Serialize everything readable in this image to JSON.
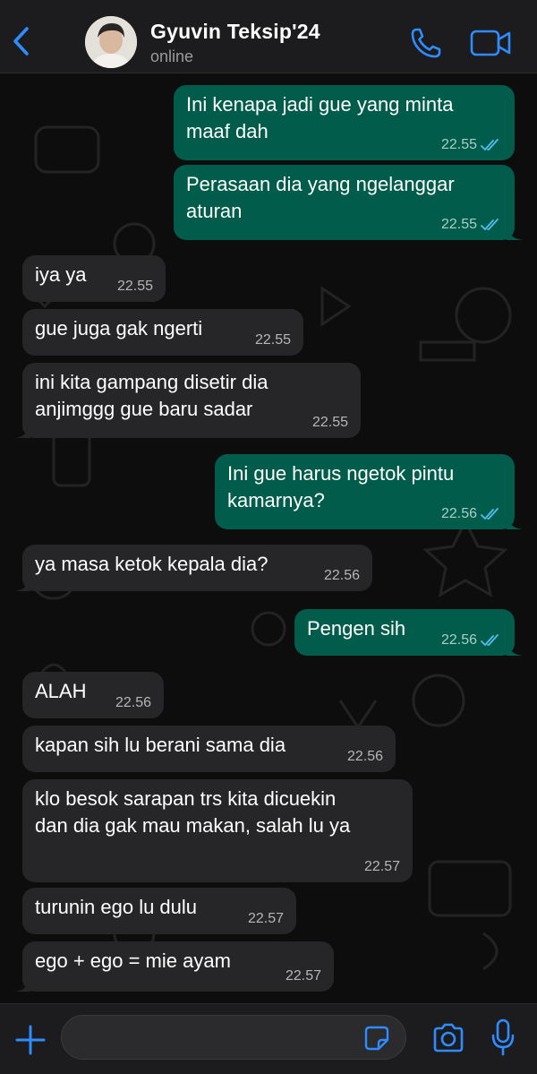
{
  "header": {
    "contact_name": "Gyuvin Teksip'24",
    "status": "online",
    "accent": "#2f8cff"
  },
  "messages": [
    {
      "dir": "out",
      "lines": [
        "Ini kenapa jadi gue yang minta",
        "maaf dah"
      ],
      "time": "22.55",
      "read": true
    },
    {
      "dir": "out",
      "lines": [
        "Perasaan dia yang ngelanggar",
        "aturan"
      ],
      "time": "22.55",
      "read": true
    },
    {
      "dir": "in",
      "lines": [
        "iya ya"
      ],
      "time": "22.55"
    },
    {
      "dir": "in",
      "lines": [
        "gue juga gak ngerti"
      ],
      "time": "22.55"
    },
    {
      "dir": "in",
      "lines": [
        "ini kita gampang disetir dia",
        "anjimggg gue baru sadar"
      ],
      "time": "22.55"
    },
    {
      "dir": "out",
      "lines": [
        "Ini gue harus ngetok pintu",
        "kamarnya?"
      ],
      "time": "22.56",
      "read": true
    },
    {
      "dir": "in",
      "lines": [
        "ya masa ketok kepala dia?"
      ],
      "time": "22.56"
    },
    {
      "dir": "out",
      "lines": [
        "Pengen sih"
      ],
      "time": "22.56",
      "read": true
    },
    {
      "dir": "in",
      "lines": [
        "ALAH"
      ],
      "time": "22.56"
    },
    {
      "dir": "in",
      "lines": [
        "kapan sih lu berani sama dia"
      ],
      "time": "22.56"
    },
    {
      "dir": "in",
      "lines": [
        "klo besok sarapan trs kita dicuekin",
        "dan dia gak mau makan, salah lu ya"
      ],
      "time": "22.57"
    },
    {
      "dir": "in",
      "lines": [
        "turunin ego lu dulu"
      ],
      "time": "22.57"
    },
    {
      "dir": "in",
      "lines": [
        "ego + ego = mie ayam"
      ],
      "time": "22.57"
    }
  ],
  "composer": {
    "placeholder": "",
    "value": ""
  },
  "icons": {
    "back": "chevron-left-icon",
    "call": "phone-icon",
    "video": "video-camera-icon",
    "attach": "plus-icon",
    "sticker": "sticker-icon",
    "camera": "camera-icon",
    "mic": "microphone-icon"
  },
  "colors": {
    "incoming_bubble": "#262628",
    "outgoing_bubble": "#015c4b",
    "read_ticks": "#53bdeb"
  }
}
